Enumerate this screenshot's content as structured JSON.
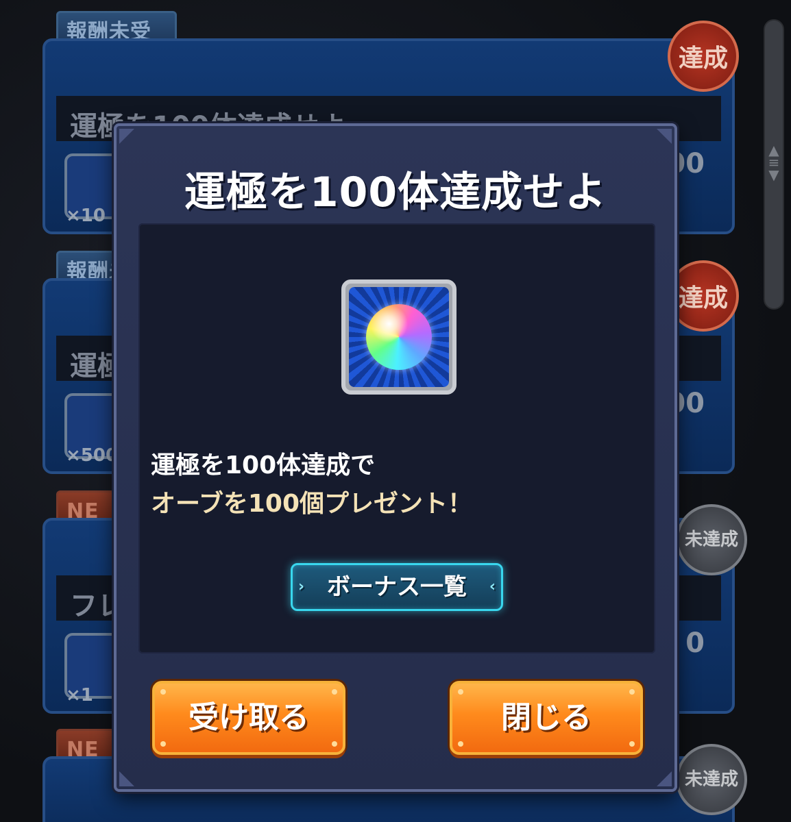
{
  "background_list": {
    "tags": [
      "報酬未受取",
      "報酬未",
      "NE",
      "NE"
    ],
    "cards": [
      {
        "title": "運極を100体達成せよ",
        "reward_count": "×10",
        "right_value": "00",
        "stamp": "達成"
      },
      {
        "title": "運極",
        "reward_count": "×500",
        "right_value": "00",
        "stamp": "達成"
      },
      {
        "title": "フレ",
        "reward_count": "×1",
        "right_value": "0",
        "stamp": "未達成"
      }
    ],
    "last_stamp": "未達成"
  },
  "modal": {
    "title": "運極を100体達成せよ",
    "reward_icon": "rainbow-orb-icon",
    "description_line1": "運極を100体達成で",
    "description_line2": "オーブを100個プレゼント！",
    "bonus_list_button": "ボーナス一覧",
    "receive_button": "受け取る",
    "close_button": "閉じる"
  },
  "colors": {
    "modal_bg": "#2c3556",
    "panel_bg": "#161b2d",
    "accent_orange": "#ff8a1c",
    "accent_cyan": "#39d7ee",
    "description_highlight": "#f4e2b6"
  }
}
